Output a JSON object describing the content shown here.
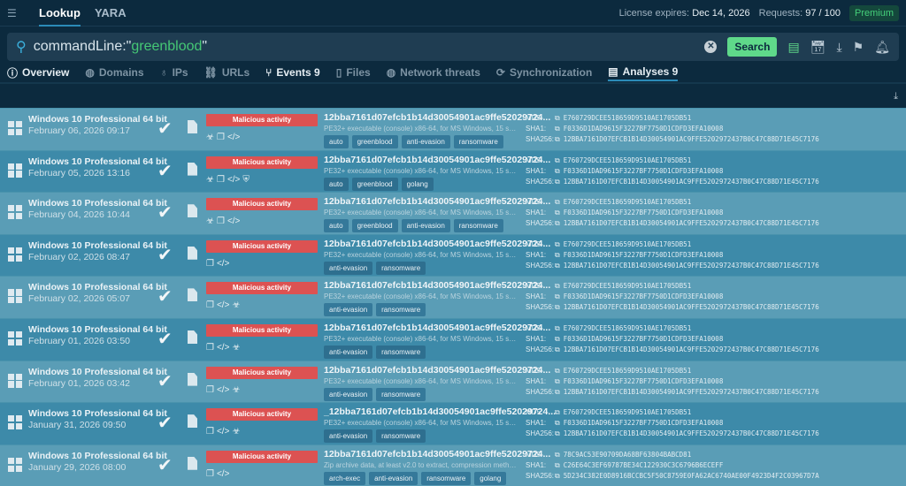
{
  "header": {
    "tabs": [
      "Lookup",
      "YARA"
    ],
    "license_label": "License expires:",
    "license_date": "Dec 14, 2026",
    "requests_label": "Requests:",
    "requests_value": "97 / 100",
    "plan": "Premium"
  },
  "search": {
    "prefix": "commandLine:\"",
    "term": "greenblood",
    "suffix": "\"",
    "button": "Search"
  },
  "tabs": [
    {
      "label": "Overview",
      "icon": "ⓘ"
    },
    {
      "label": "Domains",
      "icon": "◍"
    },
    {
      "label": "IPs",
      "icon": "♁"
    },
    {
      "label": "URLs",
      "icon": "⛓"
    },
    {
      "label": "Events 9",
      "icon": "⑂"
    },
    {
      "label": "Files",
      "icon": "▯"
    },
    {
      "label": "Network threats",
      "icon": "◍"
    },
    {
      "label": "Synchronization",
      "icon": "⟳"
    },
    {
      "label": "Analyses 9",
      "icon": "▤"
    }
  ],
  "rows": [
    {
      "os": "Windows 10 Professional 64 bit",
      "date": "February 06, 2026 09:17",
      "verdict": "Malicious activity",
      "icons": [
        "☣",
        "❐",
        "</>"
      ],
      "name": "12bba7161d07efcb1b14d30054901ac9ffe52029724...",
      "desc": "PE32+ executable (console) x86-64, for MS Windows, 15 sections",
      "tags": [
        "auto",
        "greenblood",
        "anti-evasion",
        "ransomware"
      ],
      "md5": "E760729DCEE518659D9510AE1705DB51",
      "sha1": "F0336D1DAD9615F3227BF7750D1CDFD3EFA10008",
      "sha256": "12BBA7161D07EFCB1B14D30054901AC9FFE5202972437B0C47C88D71E45C7176"
    },
    {
      "os": "Windows 10 Professional 64 bit",
      "date": "February 05, 2026 13:16",
      "verdict": "Malicious activity",
      "icons": [
        "☣",
        "❐",
        "</>",
        "⛨"
      ],
      "name": "12bba7161d07efcb1b14d30054901ac9ffe52029724...",
      "desc": "PE32+ executable (console) x86-64, for MS Windows, 15 sections",
      "tags": [
        "auto",
        "greenblood",
        "golang"
      ],
      "md5": "E760729DCEE518659D9510AE1705DB51",
      "sha1": "F0336D1DAD9615F3227BF7750D1CDFD3EFA10008",
      "sha256": "12BBA7161D07EFCB1B14D30054901AC9FFE5202972437B0C47C88D71E45C7176"
    },
    {
      "os": "Windows 10 Professional 64 bit",
      "date": "February 04, 2026 10:44",
      "verdict": "Malicious activity",
      "icons": [
        "☣",
        "❐",
        "</>"
      ],
      "name": "12bba7161d07efcb1b14d30054901ac9ffe52029724...",
      "desc": "PE32+ executable (console) x86-64, for MS Windows, 15 sections",
      "tags": [
        "auto",
        "greenblood",
        "anti-evasion",
        "ransomware"
      ],
      "md5": "E760729DCEE518659D9510AE1705DB51",
      "sha1": "F0336D1DAD9615F3227BF7750D1CDFD3EFA10008",
      "sha256": "12BBA7161D07EFCB1B14D30054901AC9FFE5202972437B0C47C88D71E45C7176"
    },
    {
      "os": "Windows 10 Professional 64 bit",
      "date": "February 02, 2026 08:47",
      "verdict": "Malicious activity",
      "icons": [
        "❐",
        "</>"
      ],
      "name": "12bba7161d07efcb1b14d30054901ac9ffe52029724...",
      "desc": "PE32+ executable (console) x86-64, for MS Windows, 15 sections",
      "tags": [
        "anti-evasion",
        "ransomware"
      ],
      "md5": "E760729DCEE518659D9510AE1705DB51",
      "sha1": "F0336D1DAD9615F3227BF7750D1CDFD3EFA10008",
      "sha256": "12BBA7161D07EFCB1B14D30054901AC9FFE5202972437B0C47C88D71E45C7176"
    },
    {
      "os": "Windows 10 Professional 64 bit",
      "date": "February 02, 2026 05:07",
      "verdict": "Malicious activity",
      "icons": [
        "❐",
        "</>",
        "☣"
      ],
      "name": "12bba7161d07efcb1b14d30054901ac9ffe52029724...",
      "desc": "PE32+ executable (console) x86-64, for MS Windows, 15 sections",
      "tags": [
        "anti-evasion",
        "ransomware"
      ],
      "md5": "E760729DCEE518659D9510AE1705DB51",
      "sha1": "F0336D1DAD9615F3227BF7750D1CDFD3EFA10008",
      "sha256": "12BBA7161D07EFCB1B14D30054901AC9FFE5202972437B0C47C88D71E45C7176"
    },
    {
      "os": "Windows 10 Professional 64 bit",
      "date": "February 01, 2026 03:50",
      "verdict": "Malicious activity",
      "icons": [
        "❐",
        "</>",
        "☣"
      ],
      "name": "12bba7161d07efcb1b14d30054901ac9ffe52029724...",
      "desc": "PE32+ executable (console) x86-64, for MS Windows, 15 sections",
      "tags": [
        "anti-evasion",
        "ransomware"
      ],
      "md5": "E760729DCEE518659D9510AE1705DB51",
      "sha1": "F0336D1DAD9615F3227BF7750D1CDFD3EFA10008",
      "sha256": "12BBA7161D07EFCB1B14D30054901AC9FFE5202972437B0C47C88D71E45C7176"
    },
    {
      "os": "Windows 10 Professional 64 bit",
      "date": "February 01, 2026 03:42",
      "verdict": "Malicious activity",
      "icons": [
        "❐",
        "</>",
        "☣"
      ],
      "name": "12bba7161d07efcb1b14d30054901ac9ffe52029724...",
      "desc": "PE32+ executable (console) x86-64, for MS Windows, 15 sections",
      "tags": [
        "anti-evasion",
        "ransomware"
      ],
      "md5": "E760729DCEE518659D9510AE1705DB51",
      "sha1": "F0336D1DAD9615F3227BF7750D1CDFD3EFA10008",
      "sha256": "12BBA7161D07EFCB1B14D30054901AC9FFE5202972437B0C47C88D71E45C7176"
    },
    {
      "os": "Windows 10 Professional 64 bit",
      "date": "January 31, 2026 09:50",
      "verdict": "Malicious activity",
      "icons": [
        "❐",
        "</>",
        "☣"
      ],
      "name": "_12bba7161d07efcb1b14d30054901ac9ffe52029724...",
      "desc": "PE32+ executable (console) x86-64, for MS Windows, 15 sections",
      "tags": [
        "anti-evasion",
        "ransomware"
      ],
      "md5": "E760729DCEE518659D9510AE1705DB51",
      "sha1": "F0336D1DAD9615F3227BF7750D1CDFD3EFA10008",
      "sha256": "12BBA7161D07EFCB1B14D30054901AC9FFE5202972437B0C47C88D71E45C7176"
    },
    {
      "os": "Windows 10 Professional 64 bit",
      "date": "January 29, 2026 08:00",
      "verdict": "Malicious activity",
      "icons": [
        "❐",
        "</>"
      ],
      "name": "12bba7161d07efcb1b14d30054901ac9ffe52029724...",
      "desc": "Zip archive data, at least v2.0 to extract, compression method=A...",
      "tags": [
        "arch-exec",
        "anti-evasion",
        "ransomware",
        "golang"
      ],
      "md5": "78C9AC53E90709DA68BF63804BABCD81",
      "sha1": "C26E64C3EF69787BE34C122930C3C6796B6ECEFF",
      "sha256": "5D234C382E0D8916BCCBC5F50C8759E0FA62AC6740AE00F4923D4F2C03967D7A"
    }
  ],
  "hash_labels": {
    "md5": "MD5:",
    "sha1": "SHA1:",
    "sha256": "SHA256:"
  }
}
